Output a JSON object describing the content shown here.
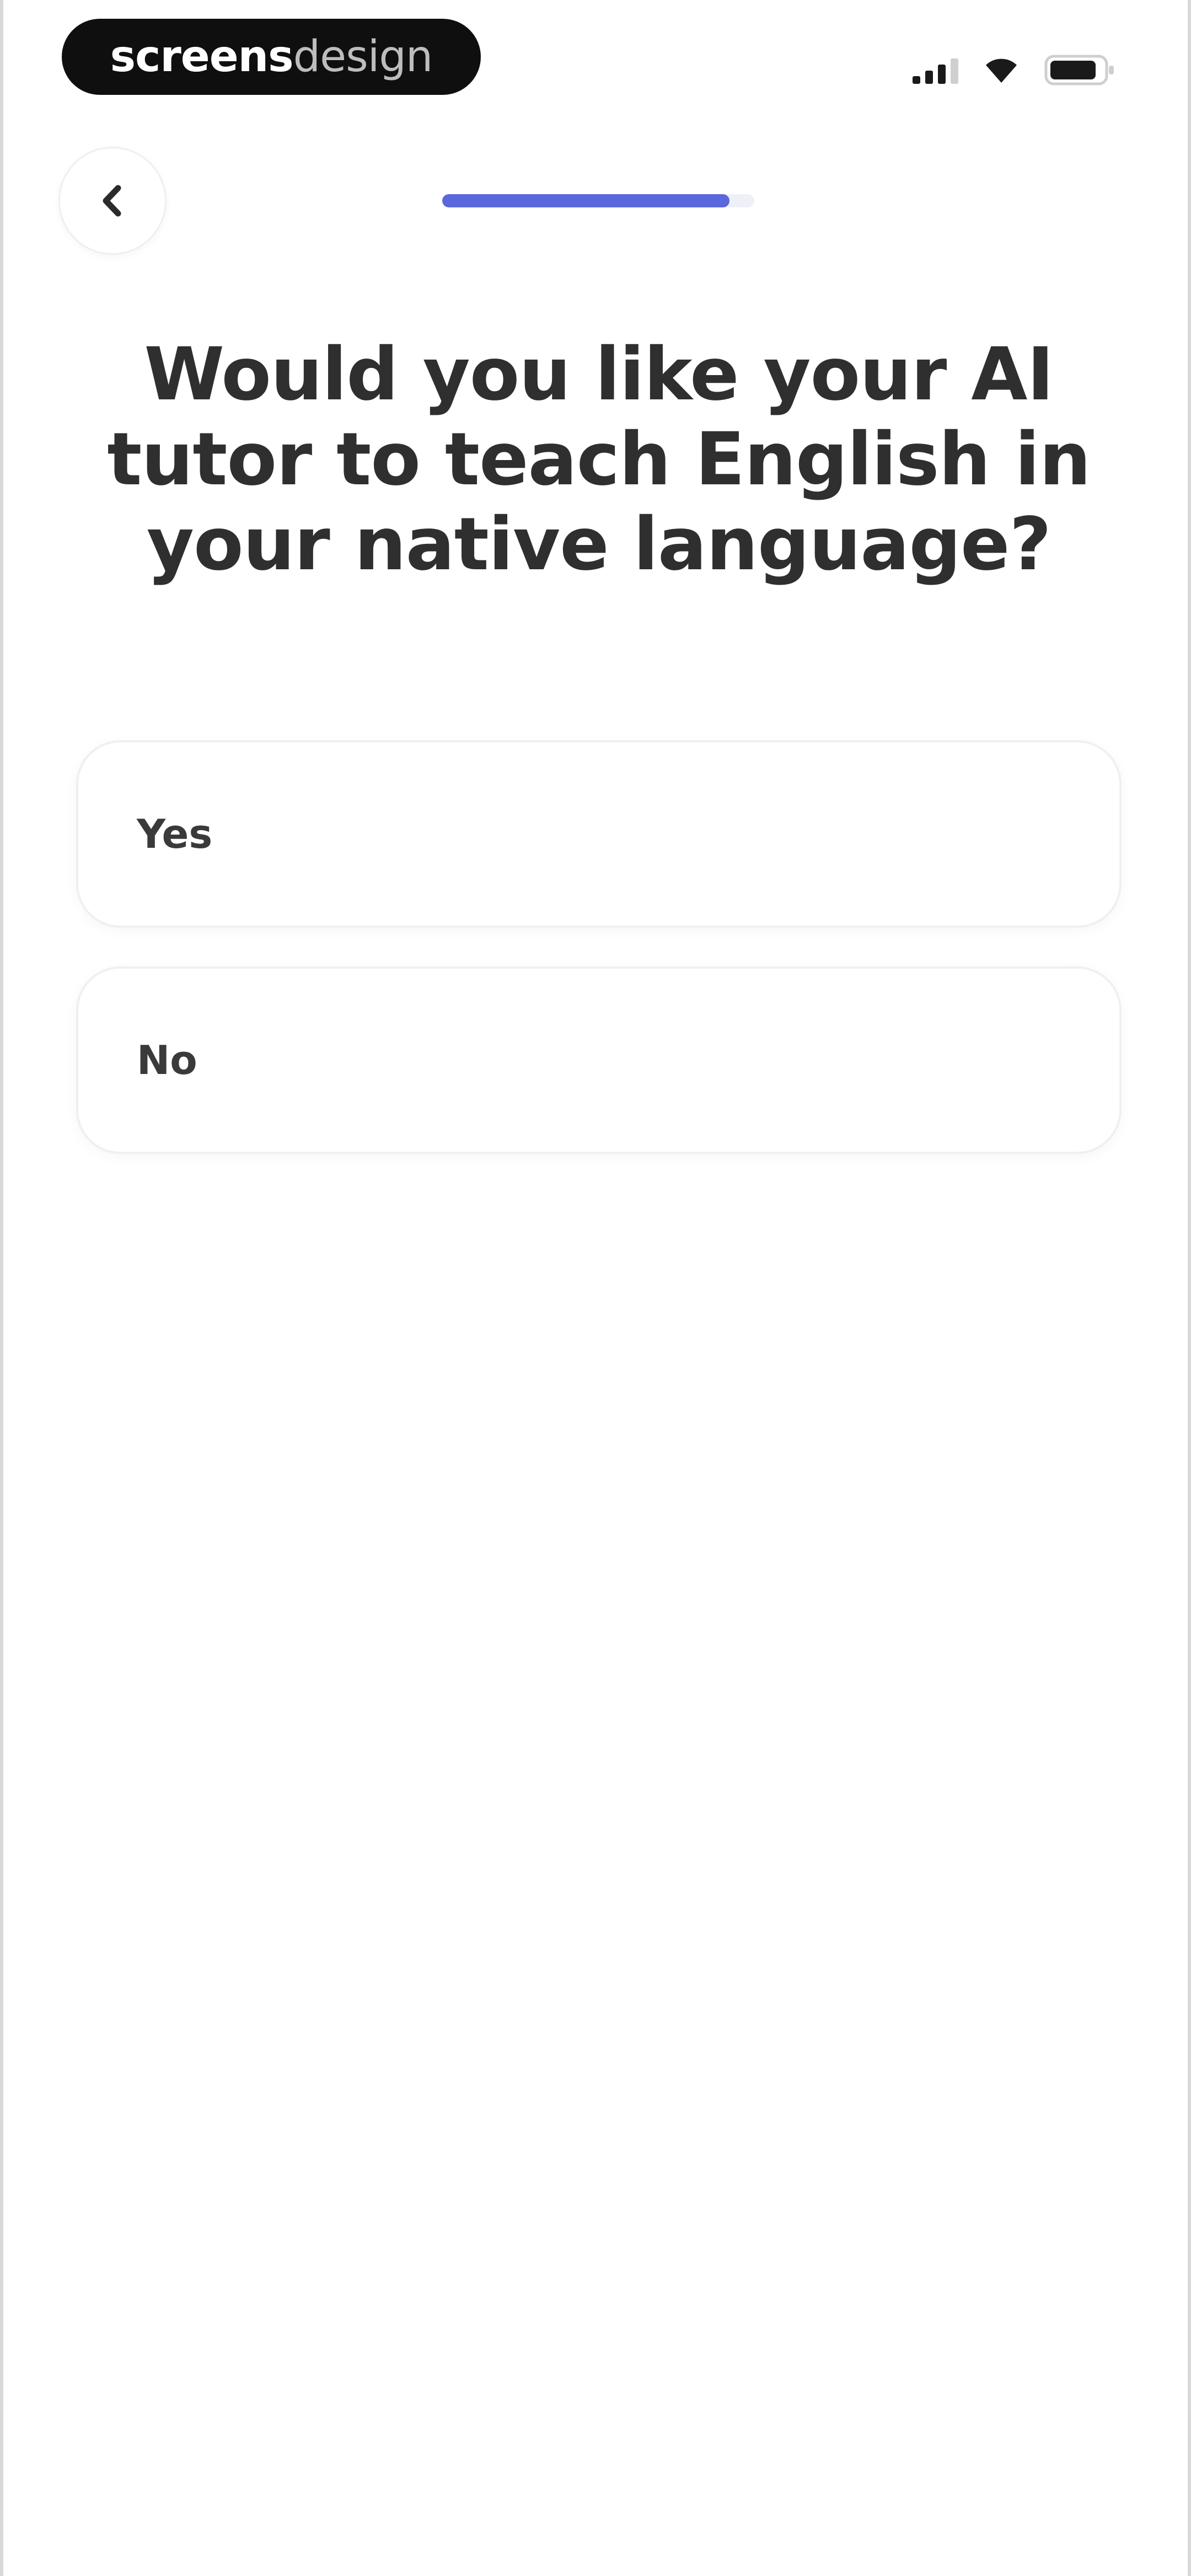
{
  "status_bar": {
    "logo_part1": "screens",
    "logo_part2": "design",
    "icons": [
      "cellular-signal-icon",
      "wifi-icon",
      "battery-icon"
    ]
  },
  "header": {
    "back_icon": "chevron-left-icon",
    "progress": 0.92,
    "progress_color": "#5b67db"
  },
  "question": {
    "title": "Would you like your AI tutor to teach English in your native language?"
  },
  "options": [
    {
      "label": "Yes"
    },
    {
      "label": "No"
    }
  ]
}
